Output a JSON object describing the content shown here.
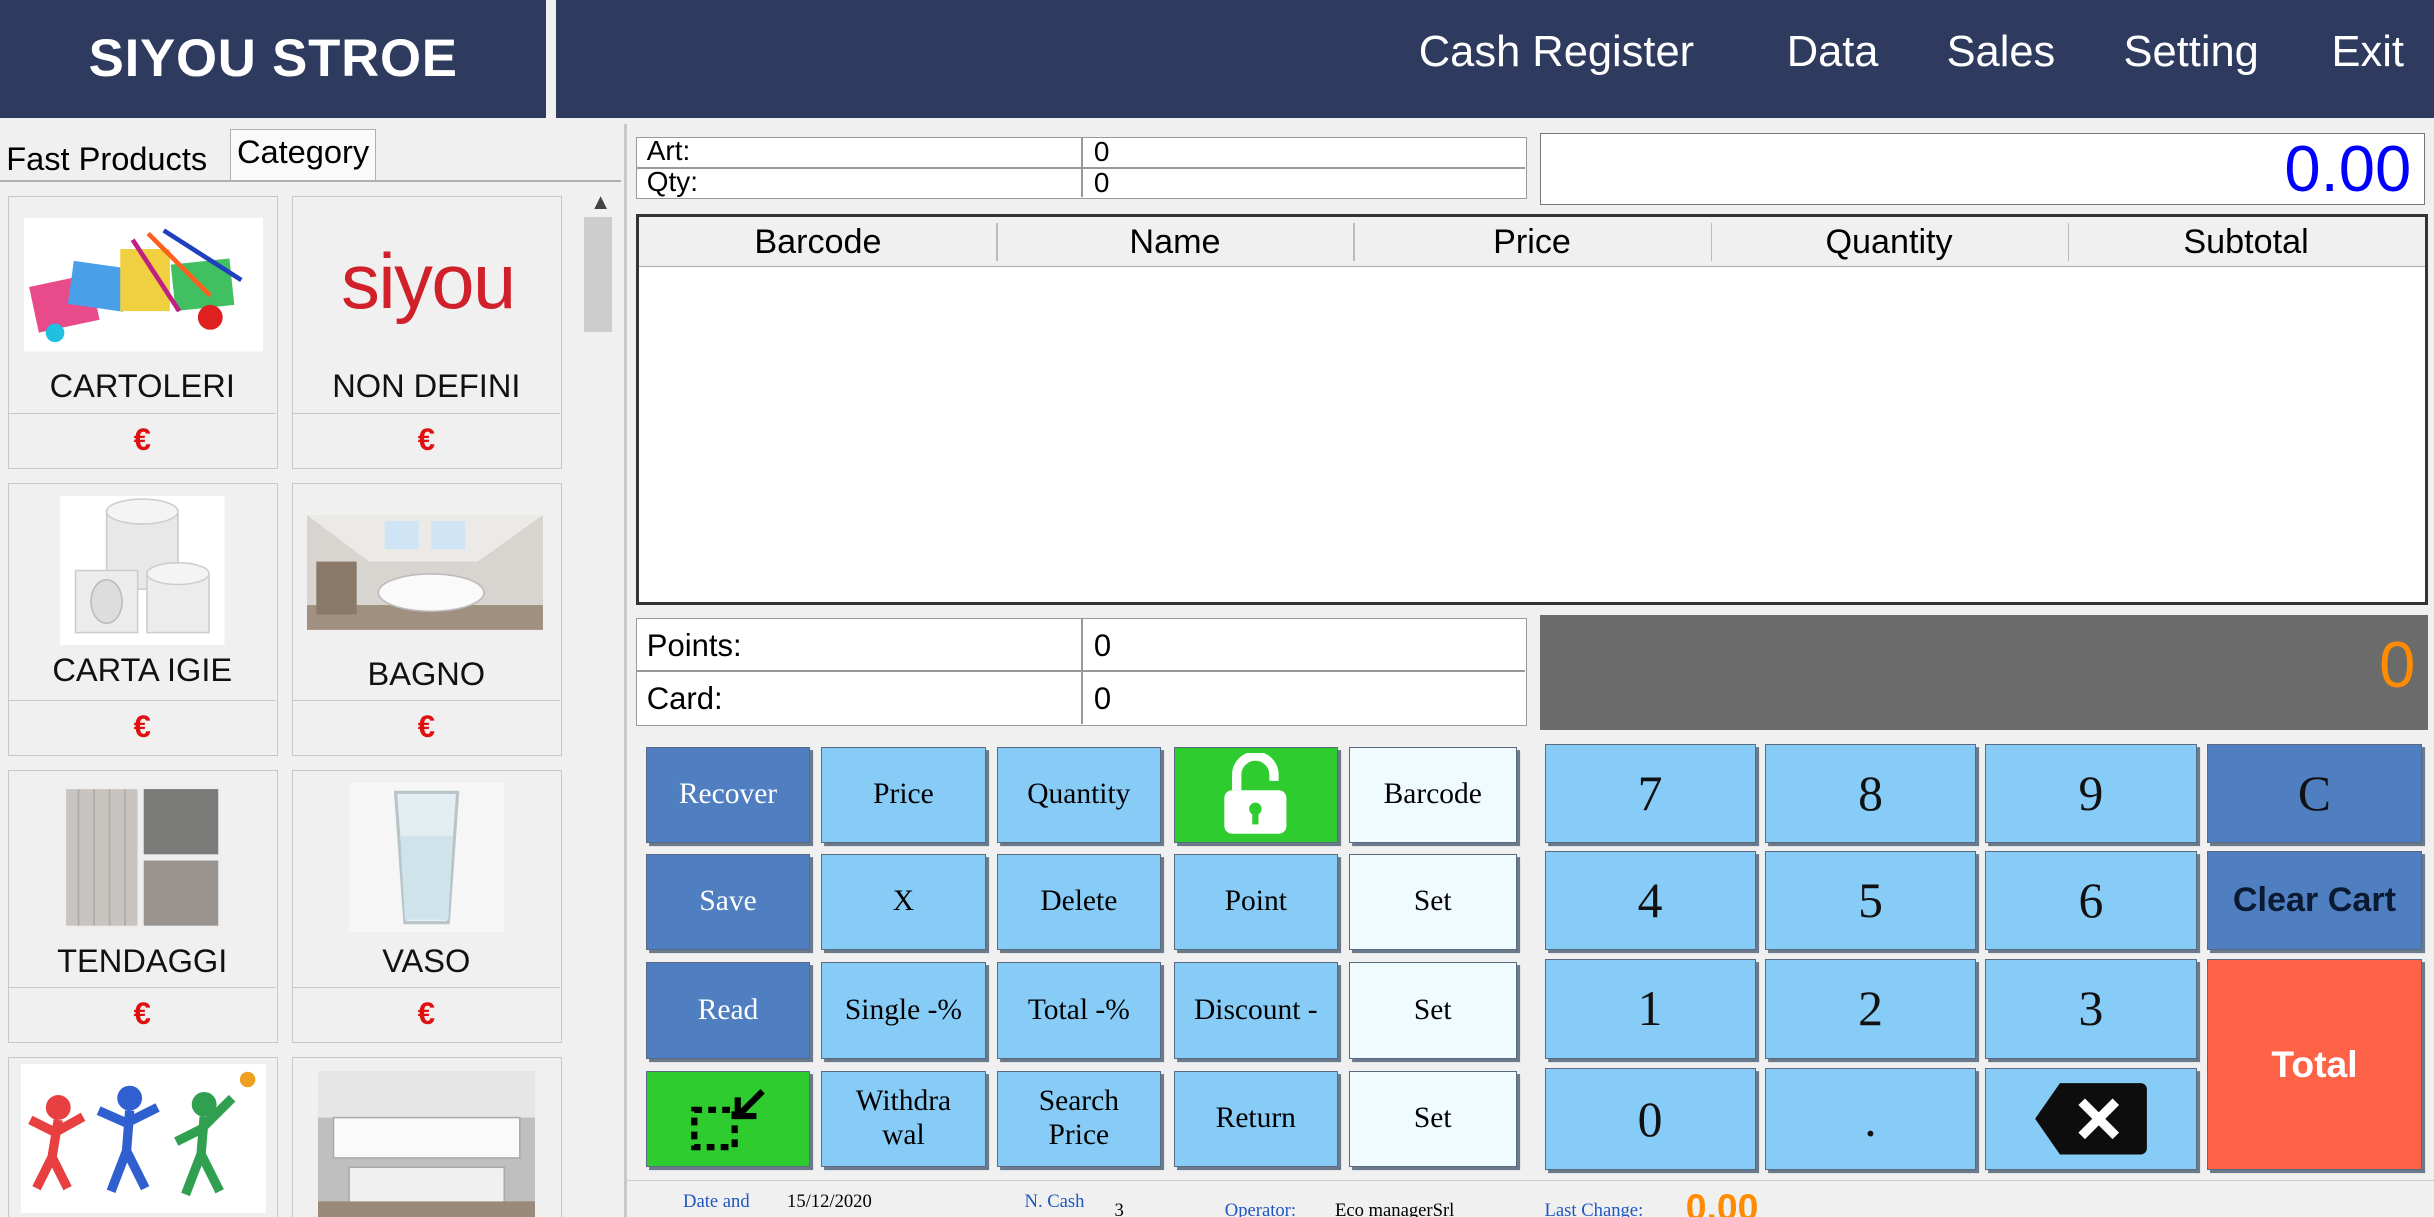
{
  "brand": "SIYOU STROE",
  "nav": [
    "Cash Register",
    "Data",
    "Sales",
    "Setting",
    "Exit"
  ],
  "tabs": {
    "fast": "Fast Products",
    "category": "Category"
  },
  "products": [
    {
      "name": "CARTOLERI",
      "price": "€"
    },
    {
      "name": "NON DEFINI",
      "price": "€"
    },
    {
      "name": "CARTA IGIE",
      "price": "€"
    },
    {
      "name": "BAGNO",
      "price": "€"
    },
    {
      "name": "TENDAGGI",
      "price": "€"
    },
    {
      "name": "VASO",
      "price": "€"
    }
  ],
  "logo_text": "siyou",
  "summary": {
    "art_label": "Art:",
    "art_value": "0",
    "qty_label": "Qty:",
    "qty_value": "0",
    "total": "0.00"
  },
  "cart": {
    "columns": [
      "Barcode",
      "Name",
      "Price",
      "Quantity",
      "Subtotal"
    ]
  },
  "points": {
    "points_label": "Points:",
    "points_value": "0",
    "card_label": "Card:",
    "card_value": "0",
    "display": "0"
  },
  "buttons": {
    "recover": "Recover",
    "price": "Price",
    "quantity": "Quantity",
    "barcode": "Barcode",
    "save": "Save",
    "x": "X",
    "delete": "Delete",
    "point": "Point",
    "set1": "Set",
    "read": "Read",
    "single_pct": "Single -%",
    "total_pct": "Total -%",
    "discount": "Discount -",
    "set2": "Set",
    "withdrawal": "Withdra wal",
    "search_price": "Search Price",
    "return": "Return",
    "set3": "Set"
  },
  "keypad": {
    "k7": "7",
    "k8": "8",
    "k9": "9",
    "c": "C",
    "k4": "4",
    "k5": "5",
    "k6": "6",
    "clear": "Clear Cart",
    "k1": "1",
    "k2": "2",
    "k3": "3",
    "total": "Total",
    "k0": "0",
    "dot": "."
  },
  "status": {
    "date_label": "Date and",
    "date_value": "15/12/2020",
    "cash_label": "N. Cash",
    "cash_value": "3",
    "operator_label": "Operator:",
    "operator_value": "Eco managerSrl",
    "last_change_label": "Last Change:",
    "last_change_value": "0.00"
  },
  "colors": {
    "navy": "#2e3b5e",
    "btn_light": "#87cbf7",
    "btn_dark": "#4f7fc0",
    "green": "#2ecc2e",
    "total_btn": "#ff6347",
    "price_red": "#e01010",
    "total_blue": "#0000ff",
    "orange": "#ff8c00"
  }
}
